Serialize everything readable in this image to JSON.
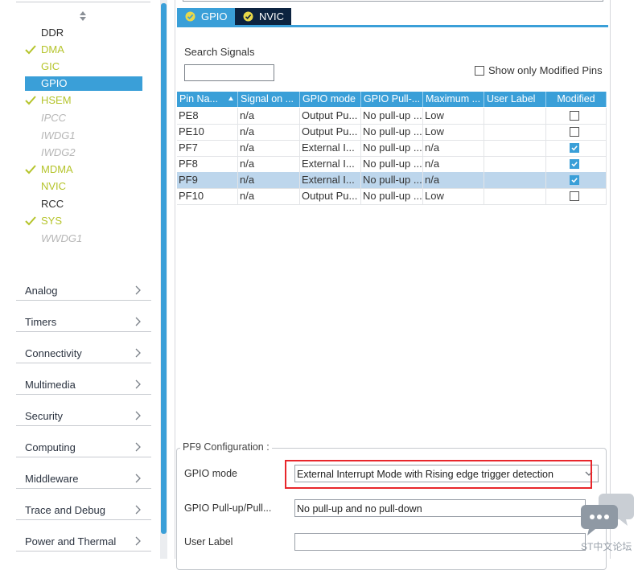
{
  "tabs": [
    {
      "label": "GPIO",
      "active": true
    },
    {
      "label": "NVIC",
      "active": false
    }
  ],
  "sidebar": {
    "peripherals": [
      {
        "label": "DDR",
        "state": "plain"
      },
      {
        "label": "DMA",
        "state": "enabled"
      },
      {
        "label": "GIC",
        "state": "active"
      },
      {
        "label": "GPIO",
        "state": "selected"
      },
      {
        "label": "HSEM",
        "state": "enabled"
      },
      {
        "label": "IPCC",
        "state": "unavailable"
      },
      {
        "label": "IWDG1",
        "state": "unavailable"
      },
      {
        "label": "IWDG2",
        "state": "unavailable"
      },
      {
        "label": "MDMA",
        "state": "enabled"
      },
      {
        "label": "NVIC",
        "state": "active"
      },
      {
        "label": "RCC",
        "state": "plain"
      },
      {
        "label": "SYS",
        "state": "enabled"
      },
      {
        "label": "WWDG1",
        "state": "unavailable"
      }
    ],
    "categories": [
      "Analog",
      "Timers",
      "Connectivity",
      "Multimedia",
      "Security",
      "Computing",
      "Middleware",
      "Trace and Debug",
      "Power and Thermal"
    ]
  },
  "search": {
    "label": "Search Signals",
    "value": ""
  },
  "show_modified": {
    "label": "Show only Modified Pins",
    "checked": false
  },
  "table": {
    "columns": [
      "Pin Na...",
      "Signal on ...",
      "GPIO mode",
      "GPIO Pull-...",
      "Maximum ...",
      "User Label",
      "Modified"
    ],
    "rows": [
      {
        "pin": "PE8",
        "signal": "n/a",
        "mode": "Output Pu...",
        "pull": "No pull-up ...",
        "speed": "Low",
        "label": "",
        "modified": false,
        "selected": false
      },
      {
        "pin": "PE10",
        "signal": "n/a",
        "mode": "Output Pu...",
        "pull": "No pull-up ...",
        "speed": "Low",
        "label": "",
        "modified": false,
        "selected": false
      },
      {
        "pin": "PF7",
        "signal": "n/a",
        "mode": "External I...",
        "pull": "No pull-up ...",
        "speed": "n/a",
        "label": "",
        "modified": true,
        "selected": false
      },
      {
        "pin": "PF8",
        "signal": "n/a",
        "mode": "External I...",
        "pull": "No pull-up ...",
        "speed": "n/a",
        "label": "",
        "modified": true,
        "selected": false
      },
      {
        "pin": "PF9",
        "signal": "n/a",
        "mode": "External I...",
        "pull": "No pull-up ...",
        "speed": "n/a",
        "label": "",
        "modified": true,
        "selected": true
      },
      {
        "pin": "PF10",
        "signal": "n/a",
        "mode": "Output Pu...",
        "pull": "No pull-up ...",
        "speed": "Low",
        "label": "",
        "modified": false,
        "selected": false
      }
    ]
  },
  "config": {
    "title": "PF9 Configuration :",
    "gpio_mode": {
      "label": "GPIO mode",
      "value": "External Interrupt Mode with Rising edge trigger detection"
    },
    "gpio_pull": {
      "label": "GPIO Pull-up/Pull...",
      "value": "No pull-up and no pull-down"
    },
    "user_label": {
      "label": "User Label",
      "value": ""
    }
  },
  "watermark": {
    "text": "ST中文论坛"
  },
  "colors": {
    "accent": "#3a9fd8",
    "tab_dark": "#0c2340",
    "enabled_green": "#b5c42b",
    "highlight_red": "#e8262b",
    "selected_row": "#bdd6ec"
  }
}
